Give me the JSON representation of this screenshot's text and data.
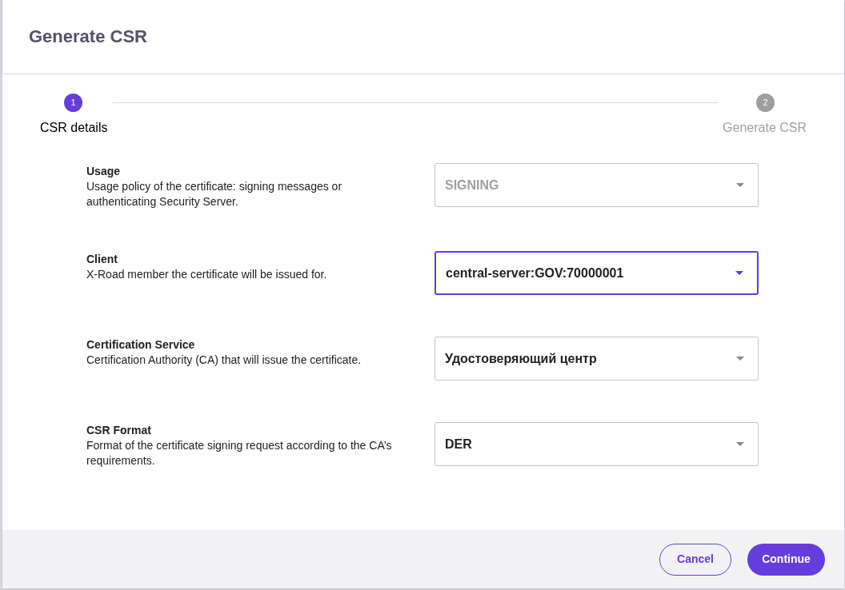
{
  "dialog": {
    "title": "Generate CSR"
  },
  "steps": [
    {
      "number": "1",
      "label": "CSR details",
      "selected": true
    },
    {
      "number": "2",
      "label": "Generate CSR",
      "selected": false
    }
  ],
  "fields": [
    {
      "label": "Usage",
      "description": "Usage policy of the certificate: signing messages or authenticating Security Server.",
      "value": "SIGNING",
      "disabled": true,
      "focused": false
    },
    {
      "label": "Client",
      "description": "X-Road member the certificate will be issued for.",
      "value": "central-server:GOV:70000001",
      "disabled": false,
      "focused": true
    },
    {
      "label": "Certification Service",
      "description": "Certification Authority (CA) that will issue the certificate.",
      "value": "Удостоверяющий центр",
      "disabled": false,
      "focused": false
    },
    {
      "label": "CSR Format",
      "description": "Format of the certificate signing request according to the CA’s requirements.",
      "value": "DER",
      "disabled": false,
      "focused": false
    }
  ],
  "buttons": {
    "cancel": "Cancel",
    "continue": "Continue"
  }
}
